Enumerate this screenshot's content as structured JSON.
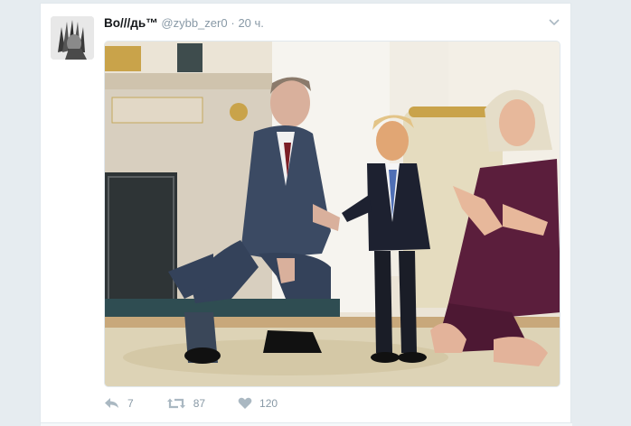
{
  "tweet": {
    "display_name": "Во///дь™",
    "handle": "@zybb_zer0",
    "separator": "·",
    "time": "20 ч.",
    "menu_icon": "chevron-down-icon"
  },
  "actions": {
    "reply": {
      "icon": "reply-icon",
      "count": "7"
    },
    "retweet": {
      "icon": "retweet-icon",
      "count": "87"
    },
    "like": {
      "icon": "heart-icon",
      "count": "120"
    }
  },
  "colors": {
    "text_primary": "#14171a",
    "text_secondary": "#8899a6",
    "border": "#e1e8ed",
    "background": "#e6ecf0"
  }
}
